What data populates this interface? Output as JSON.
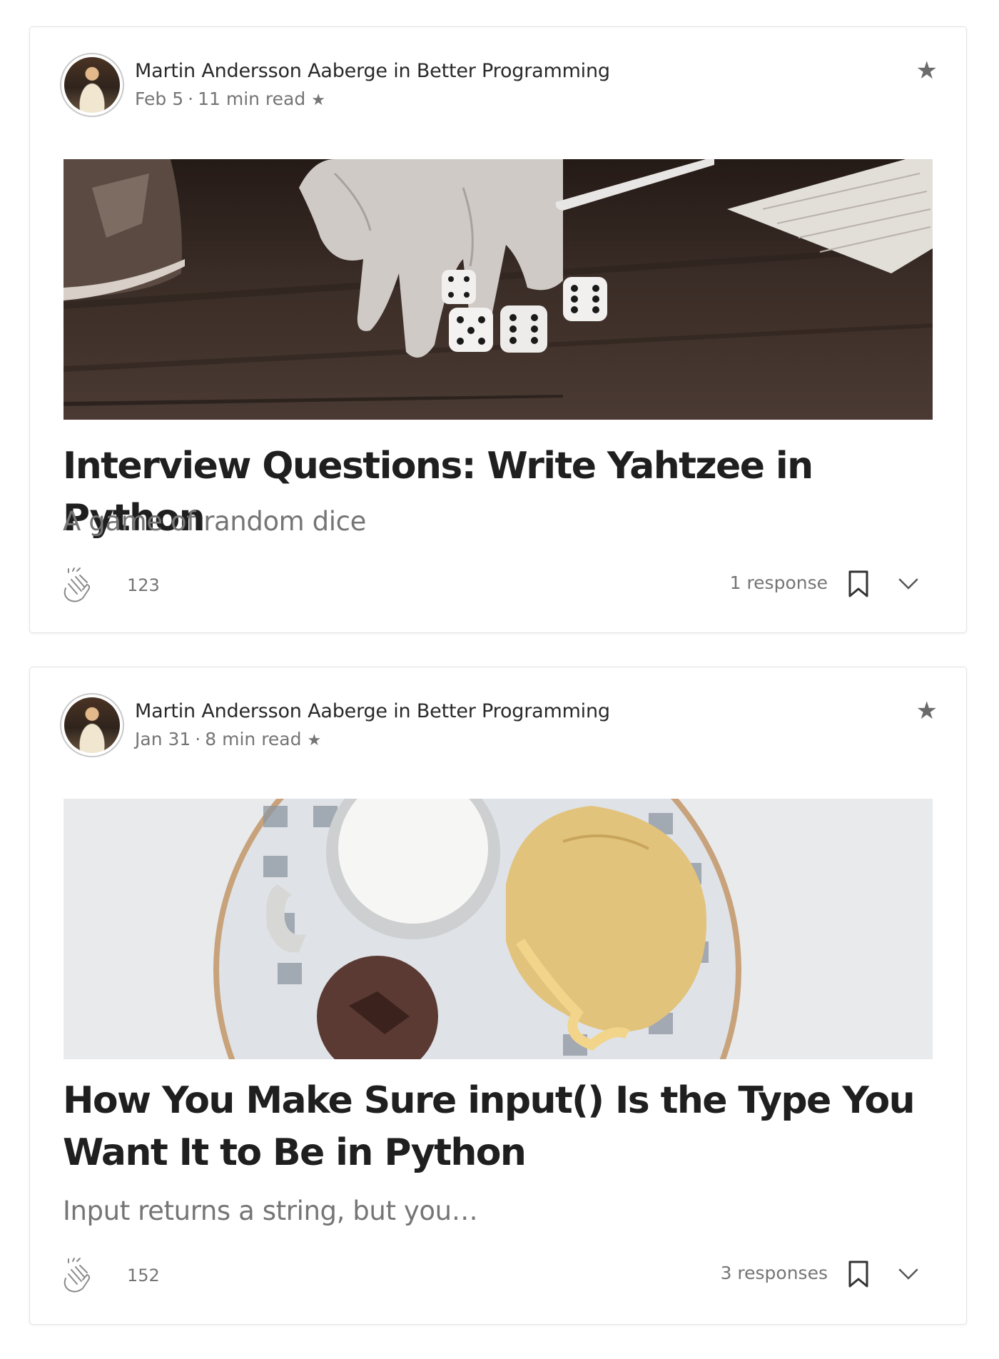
{
  "posts": [
    {
      "author": "Martin Andersson Aaberge",
      "connector": "in",
      "publication": "Better Programming",
      "date": "Feb 5",
      "read_time": "11 min read",
      "image_icon": "dice-photo",
      "title": "Interview Questions: Write Yahtzee in Python",
      "subtitle": "A game of random dice",
      "claps": "123",
      "responses": "1 response"
    },
    {
      "author": "Martin Andersson Aaberge",
      "connector": "in",
      "publication": "Better Programming",
      "date": "Jan 31",
      "read_time": "8 min read",
      "image_icon": "breakfast-plate-photo",
      "title": "How You Make Sure input() Is the Type You Want It to Be in Python",
      "subtitle": "Input returns a string, but you…",
      "claps": "152",
      "responses": "3 responses"
    }
  ],
  "glyphs": {
    "dot": "·",
    "star": "★"
  },
  "colors": {
    "text": "#292929",
    "muted": "#757575",
    "border": "#e3e3e3"
  }
}
